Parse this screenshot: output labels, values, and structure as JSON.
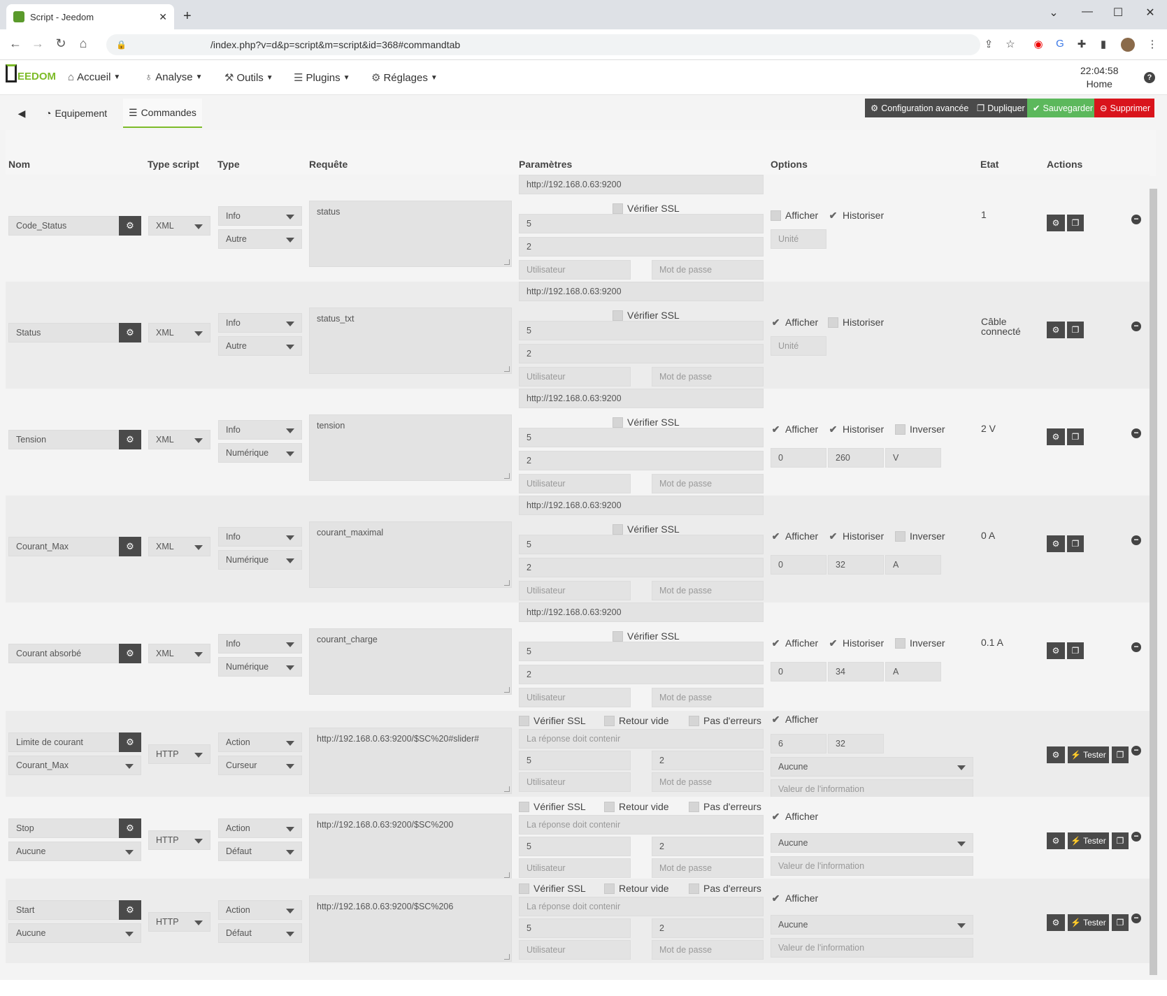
{
  "browser": {
    "tab_title": "Script - Jeedom",
    "url": "/index.php?v=d&p=script&m=script&id=368#commandtab"
  },
  "nav": {
    "logo": "EEDOM",
    "menus": [
      "Accueil",
      "Analyse",
      "Outils",
      "Plugins",
      "Réglages"
    ],
    "time": "22:04:58",
    "location": "Home"
  },
  "tabs": {
    "equipment": "Equipement",
    "commands": "Commandes"
  },
  "toolbar": {
    "advanced": "Configuration avancée",
    "duplicate": "Dupliquer",
    "save": "Sauvegarder",
    "delete": "Supprimer",
    "colors": {
      "dark": "#4a4a4a",
      "save": "#5cb85c",
      "delete": "#d9141c"
    }
  },
  "headers": {
    "name": "Nom",
    "script_type": "Type script",
    "type": "Type",
    "request": "Requête",
    "params": "Paramètres",
    "options": "Options",
    "state": "Etat",
    "actions": "Actions"
  },
  "labels": {
    "verify_ssl": "Vérifier SSL",
    "show": "Afficher",
    "historize": "Historiser",
    "invert": "Inverser",
    "empty_return": "Retour vide",
    "no_errors": "Pas d'erreurs",
    "user": "Utilisateur",
    "password": "Mot de passe",
    "unit": "Unité",
    "must_contain": "La réponse doit contenir",
    "info_value": "Valeur de l'information",
    "test": "Tester",
    "none": "Aucune"
  },
  "info_rows": [
    {
      "name": "Code_Status",
      "script_type": "XML",
      "type": "Info",
      "subtype": "Autre",
      "request": "status",
      "url": "http://192.168.0.63:9200",
      "p1": "5",
      "p2": "2",
      "show": false,
      "historize": true,
      "state": "1",
      "unit": ""
    },
    {
      "name": "Status",
      "script_type": "XML",
      "type": "Info",
      "subtype": "Autre",
      "request": "status_txt",
      "url": "http://192.168.0.63:9200",
      "p1": "5",
      "p2": "2",
      "show": true,
      "historize": false,
      "state": "Câble connecté",
      "unit": ""
    },
    {
      "name": "Tension",
      "script_type": "XML",
      "type": "Info",
      "subtype": "Numérique",
      "request": "tension",
      "url": "http://192.168.0.63:9200",
      "p1": "5",
      "p2": "2",
      "show": true,
      "historize": true,
      "invert": false,
      "min": "0",
      "max": "260",
      "unit": "V",
      "state": "2 V"
    },
    {
      "name": "Courant_Max",
      "script_type": "XML",
      "type": "Info",
      "subtype": "Numérique",
      "request": "courant_maximal",
      "url": "http://192.168.0.63:9200",
      "p1": "5",
      "p2": "2",
      "show": true,
      "historize": true,
      "invert": false,
      "min": "0",
      "max": "32",
      "unit": "A",
      "state": "0 A"
    },
    {
      "name": "Courant absorbé",
      "script_type": "XML",
      "type": "Info",
      "subtype": "Numérique",
      "request": "courant_charge",
      "url": "http://192.168.0.63:9200",
      "p1": "5",
      "p2": "2",
      "show": true,
      "historize": true,
      "invert": false,
      "min": "0",
      "max": "34",
      "unit": "A",
      "state": "0.1 A"
    }
  ],
  "action_rows": [
    {
      "name": "Limite de courant",
      "linked": "Courant_Max",
      "script_type": "HTTP",
      "type": "Action",
      "subtype": "Curseur",
      "request": "http://192.168.0.63:9200/$SC%20#slider#",
      "p1": "5",
      "p2": "2",
      "min": "6",
      "max": "32",
      "select": "Aucune"
    },
    {
      "name": "Stop",
      "linked": "Aucune",
      "script_type": "HTTP",
      "type": "Action",
      "subtype": "Défaut",
      "request": "http://192.168.0.63:9200/$SC%200",
      "p1": "5",
      "p2": "2",
      "select": "Aucune"
    },
    {
      "name": "Start",
      "linked": "Aucune",
      "script_type": "HTTP",
      "type": "Action",
      "subtype": "Défaut",
      "request": "http://192.168.0.63:9200/$SC%206",
      "p1": "5",
      "p2": "2",
      "select": "Aucune"
    }
  ]
}
